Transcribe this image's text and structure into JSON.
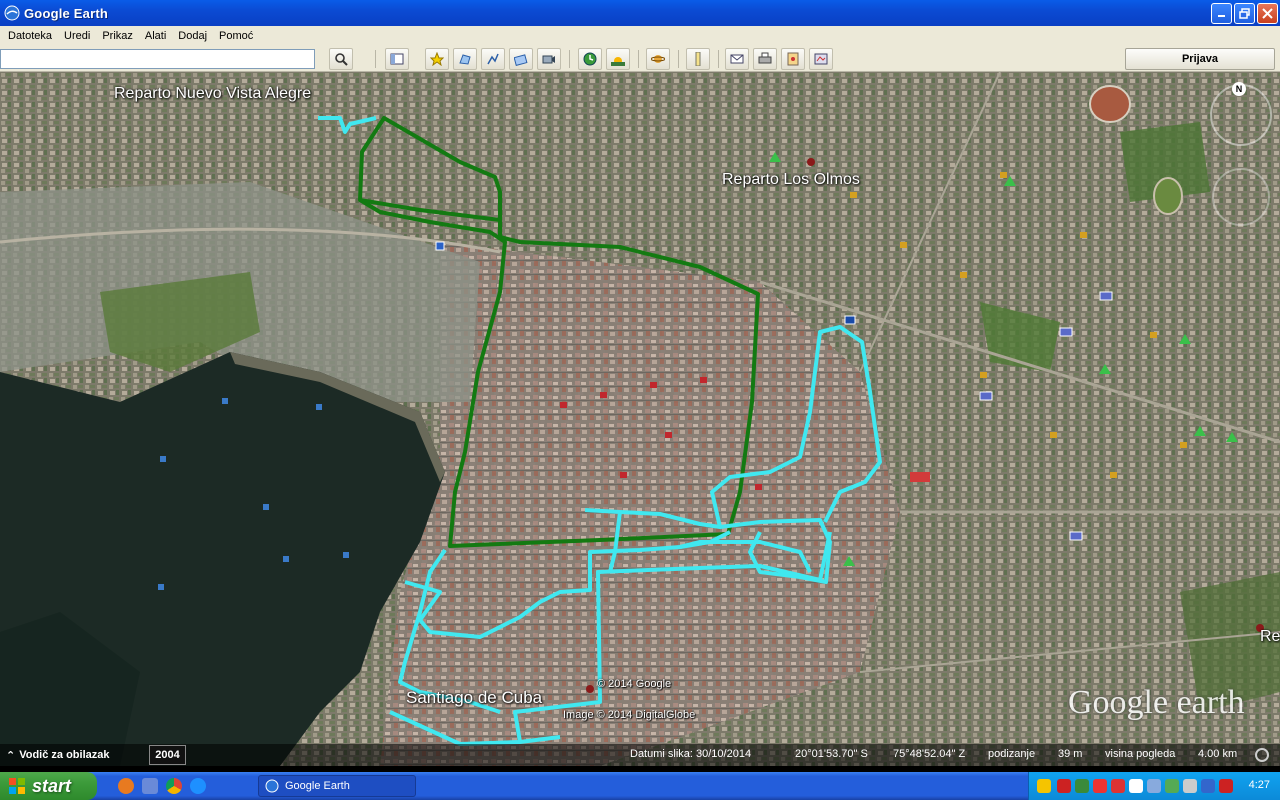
{
  "window": {
    "title": "Google Earth"
  },
  "menu": [
    "Datoteka",
    "Uredi",
    "Prikaz",
    "Alati",
    "Dodaj",
    "Pomoć"
  ],
  "toolbar": {
    "search_value": "",
    "login_label": "Prijava"
  },
  "map": {
    "labels": {
      "vista_alegre": "Reparto Nuevo Vista Alegre",
      "los_olmos": "Reparto Los Olmos",
      "santiago": "Santiago de Cuba",
      "edge_label": "Re"
    },
    "credits": {
      "google": "© 2014 Google",
      "digitalglobe": "Image © 2014 DigitalGlobe",
      "logo": "Google earth"
    },
    "compass_letter": "N",
    "track_colors": {
      "green": "#137a12",
      "cyan": "#40e8f0"
    }
  },
  "status": {
    "tour_guide": "Vodič za obilazak",
    "year": "2004",
    "image_date": "Datumi slika: 30/10/2014",
    "lat": "20°01'53.70\" S",
    "lon": "75°48'52.04\" Z",
    "elevation_label": "podizanje",
    "elevation": "39 m",
    "eye_label": "visina pogleda",
    "eye": "4.00 km"
  },
  "taskbar": {
    "start": "start",
    "task_google_earth": "Google Earth",
    "clock": "4:27"
  }
}
